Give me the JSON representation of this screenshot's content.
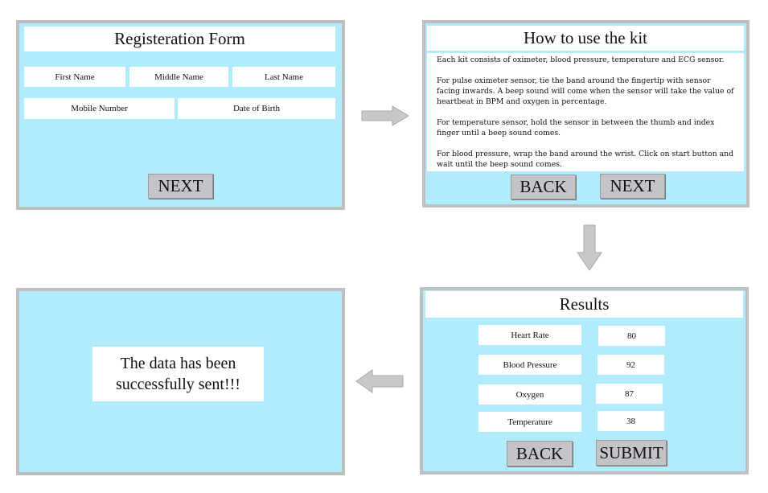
{
  "registration": {
    "title": "Registeration Form",
    "fields": [
      "First Name",
      "Middle Name",
      "Last Name",
      "Mobile Number",
      "Date of Birth"
    ],
    "next_label": "NEXT"
  },
  "instructions": {
    "title": "How to use the kit",
    "paragraphs": [
      "Each kit consists of oximeter, blood pressure, temperature and ECG sensor.",
      "For pulse oximeter sensor, tie the band around the fingertip with sensor facing inwards. A beep sound will come when the sensor will take the value of heartbeat in BPM and oxygen in percentage.",
      "For temperature sensor, hold the sensor in between the thumb and index finger until a beep sound comes.",
      "For blood pressure, wrap the band around the wrist. Click on start button and wait until the beep sound comes."
    ],
    "back_label": "BACK",
    "next_label": "NEXT"
  },
  "results": {
    "title": "Results",
    "rows": [
      {
        "label": "Heart Rate",
        "value": "80"
      },
      {
        "label": "Blood Pressure",
        "value": "92"
      },
      {
        "label": "Oxygen",
        "value": "87"
      },
      {
        "label": "Temperature",
        "value": "38"
      }
    ],
    "back_label": "BACK",
    "submit_label": "SUBMIT"
  },
  "confirmation": {
    "message": "The data has been successfully sent!!!"
  },
  "colors": {
    "panel_bg": "#b0ecfd",
    "panel_border": "#bfbfbf",
    "button": "#c4c3c8",
    "arrow": "#c8c8c8"
  }
}
